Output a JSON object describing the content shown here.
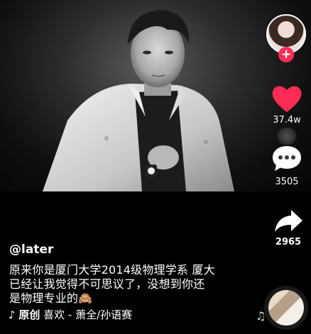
{
  "video": {
    "description_alt": ""
  },
  "author": {
    "username": "@later"
  },
  "post": {
    "caption_line1": "原来你是厦门大学2014级物理学系 厦大",
    "caption_line2": "已经让我觉得不可思议了，没想到你还",
    "caption_line3": "是物理专业的🙈"
  },
  "music": {
    "origin_label": "原创",
    "track": "喜欢 - 萧全/孙语赛"
  },
  "actions": {
    "likes": "37.4w",
    "comments": "3505",
    "shares": "2965"
  },
  "follow": {
    "symbol": "+"
  },
  "colors": {
    "accent": "#fe2c55",
    "background": "#000000"
  },
  "icons": [
    "heart-icon",
    "comment-icon",
    "share-icon",
    "tiktok-note-icon",
    "music-note-icon",
    "plus-icon"
  ]
}
